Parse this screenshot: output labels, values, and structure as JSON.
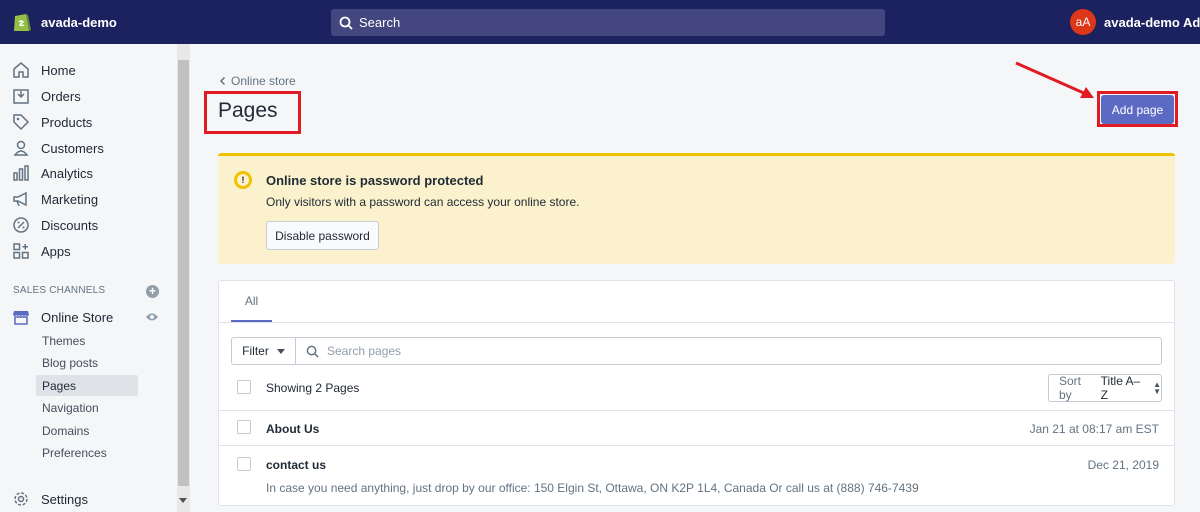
{
  "topbar": {
    "store_name": "avada-demo",
    "search_label": "Search",
    "avatar_initials": "aA",
    "account_name": "avada-demo Admin"
  },
  "sidebar": {
    "items": [
      {
        "label": "Home",
        "icon": "home-icon"
      },
      {
        "label": "Orders",
        "icon": "orders-icon"
      },
      {
        "label": "Products",
        "icon": "tag-icon"
      },
      {
        "label": "Customers",
        "icon": "person-icon"
      },
      {
        "label": "Analytics",
        "icon": "bar-chart-icon"
      },
      {
        "label": "Marketing",
        "icon": "megaphone-icon"
      },
      {
        "label": "Discounts",
        "icon": "discount-icon"
      },
      {
        "label": "Apps",
        "icon": "apps-icon"
      }
    ],
    "section_title": "SALES CHANNELS",
    "online_store": "Online Store",
    "sub_items": [
      "Themes",
      "Blog posts",
      "Pages",
      "Navigation",
      "Domains",
      "Preferences"
    ],
    "active_sub_item": "Pages",
    "settings": "Settings"
  },
  "main": {
    "back_label": "Online store",
    "title": "Pages",
    "add_button": "Add page",
    "banner": {
      "title": "Online store is password protected",
      "text": "Only visitors with a password can access your online store.",
      "button": "Disable password"
    },
    "tab_all": "All",
    "filter_label": "Filter",
    "search_placeholder": "Search pages",
    "showing": "Showing 2 Pages",
    "sort_prefix": "Sort by",
    "sort_value": "Title A–Z",
    "rows": [
      {
        "title": "About Us",
        "date": "Jan 21 at 08:17 am EST",
        "desc": ""
      },
      {
        "title": "contact us",
        "date": "Dec 21, 2019",
        "desc": "In case you need anything, just drop by our office: 150 Elgin St, Ottawa, ON K2P 1L4, Canada Or call us at (888) 746-7439"
      }
    ]
  },
  "colors": {
    "topbar": "#1c2260",
    "accent": "#5c6ac4",
    "annotation": "#e01b24",
    "banner_bg": "#fcf1cd",
    "banner_border": "#eec200"
  }
}
